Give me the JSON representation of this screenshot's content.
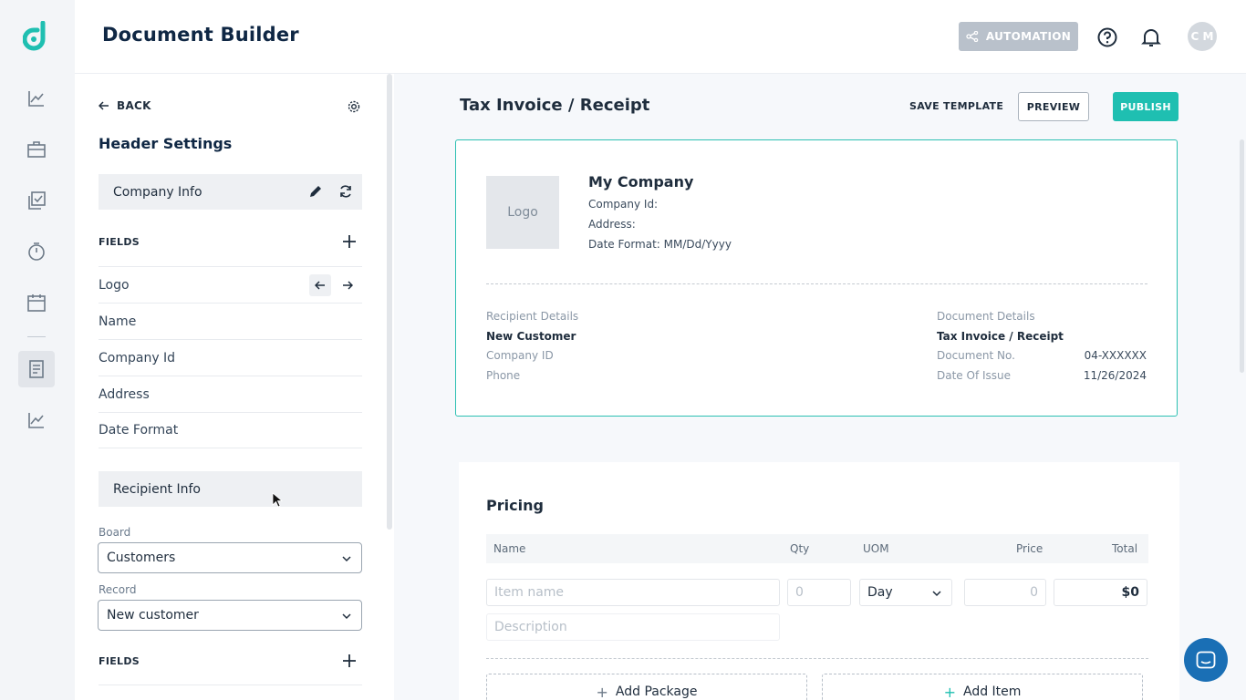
{
  "app": {
    "title": "Document Builder"
  },
  "topbar": {
    "automation_label": "AUTOMATION",
    "avatar_initials": "C M"
  },
  "panel": {
    "back_label": "BACK",
    "heading": "Header Settings",
    "company_section": "Company Info",
    "fields_label": "FIELDS",
    "company_fields": [
      "Logo",
      "Name",
      "Company Id",
      "Address",
      "Date Format"
    ],
    "recipient_section": "Recipient Info",
    "board_label": "Board",
    "board_value": "Customers",
    "record_label": "Record",
    "record_value": "New customer",
    "fields_label_2": "FIELDS"
  },
  "main": {
    "title": "Tax Invoice / Receipt",
    "save_template": "SAVE TEMPLATE",
    "preview": "PREVIEW",
    "publish": "PUBLISH"
  },
  "document": {
    "logo_text": "Logo",
    "company_name": "My Company",
    "company_id_label": "Company Id:",
    "address_label": "Address:",
    "date_format_label": "Date Format:  MM/Dd/Yyyy",
    "recipient": {
      "heading": "Recipient Details",
      "name": "New Customer",
      "company_id": "Company ID",
      "phone": "Phone"
    },
    "details": {
      "heading": "Document Details",
      "type": "Tax Invoice / Receipt",
      "doc_no_label": "Document No.",
      "doc_no_value": "04-XXXXXX",
      "date_label": "Date Of Issue",
      "date_value": "11/26/2024"
    }
  },
  "pricing": {
    "title": "Pricing",
    "columns": {
      "name": "Name",
      "qty": "Qty",
      "uom": "UOM",
      "price": "Price",
      "total": "Total"
    },
    "item_name_placeholder": "Item name",
    "qty_placeholder": "0",
    "uom_value": "Day",
    "price_placeholder": "0",
    "total_value": "$0",
    "description_placeholder": "Description",
    "add_package": "Add Package",
    "add_item": "Add Item"
  },
  "colors": {
    "accent": "#1fbfb1",
    "navy": "#0f2744",
    "chat": "#1a6fb5"
  }
}
